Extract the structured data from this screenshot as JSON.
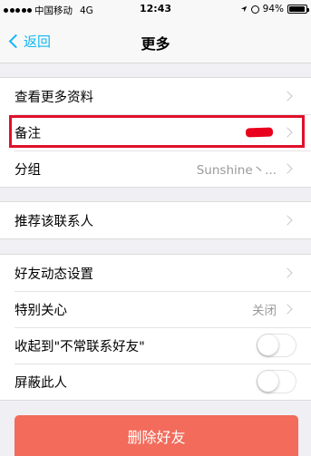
{
  "status_bar": {
    "carrier": "中国移动",
    "network": "4G",
    "time": "12:43",
    "battery": "94%",
    "icons": [
      "signal-dots-icon",
      "location-arrow-icon",
      "alarm-icon",
      "battery-icon"
    ]
  },
  "nav": {
    "back_label": "返回",
    "title": "更多"
  },
  "groups": {
    "profile": {
      "view_more": "查看更多资料",
      "remark": "备注",
      "group": "分组",
      "group_value": "Sunshine丶..."
    },
    "recommend": {
      "label": "推荐该联系人"
    },
    "settings": {
      "feed_settings": "好友动态设置",
      "special_care": "特别关心",
      "special_care_value": "关闭",
      "collapse_label": "收起到\"不常联系好友\"",
      "block_label": "屏蔽此人"
    }
  },
  "delete_button": "删除好友",
  "colors": {
    "accent": "#12b7f5",
    "delete": "#f26b5b",
    "highlight": "#e0102a"
  }
}
